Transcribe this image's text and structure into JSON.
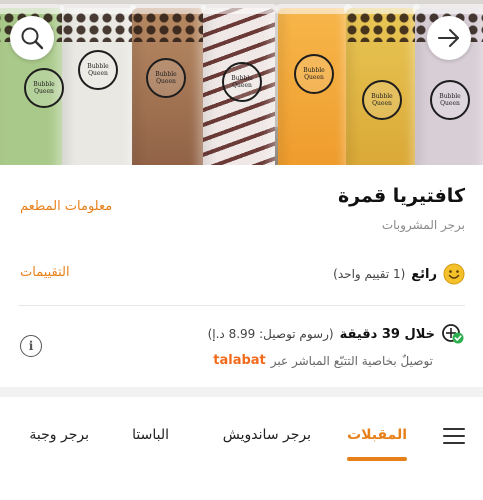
{
  "hero": {
    "logo_text": "Bubble Queen",
    "cups": [
      {
        "color": "#a9c98a"
      },
      {
        "color": "#e9e8e2"
      },
      {
        "color": "#9a6f55"
      },
      {
        "color": "#e7dfe0"
      },
      {
        "color": "#f0a73a"
      },
      {
        "color": "#e3c24a"
      },
      {
        "color": "#d8cfd6"
      }
    ]
  },
  "restaurant": {
    "name": "كافتيريا قمرة",
    "category": "برجر المشروبات",
    "info_link": "معلومات المطعم",
    "rating_label": "رائع",
    "rating_count": "(1 تقييم واحد)",
    "reviews_link": "التقييمات",
    "delivery_time": "خلال 39 دقيقة",
    "delivery_fee": "(رسوم توصيل: 8.99 د.إ)",
    "tracking_text": "توصيلٌ بخاصية التتبّع المباشر عبر",
    "tracking_brand": "talabat"
  },
  "tabs": [
    {
      "label": "المقبلات",
      "active": true
    },
    {
      "label": "برجر ساندويش",
      "active": false
    },
    {
      "label": "الباستا",
      "active": false
    },
    {
      "label": "برجر وجبة",
      "active": false
    }
  ],
  "colors": {
    "accent": "#e8801a",
    "brand": "#f26b1d",
    "rating": "#f5c12b",
    "check": "#2eae4e"
  },
  "icons": {
    "search": "search-icon",
    "back": "arrow-right-icon",
    "info": "info-icon",
    "menu": "hamburger-menu-icon"
  }
}
